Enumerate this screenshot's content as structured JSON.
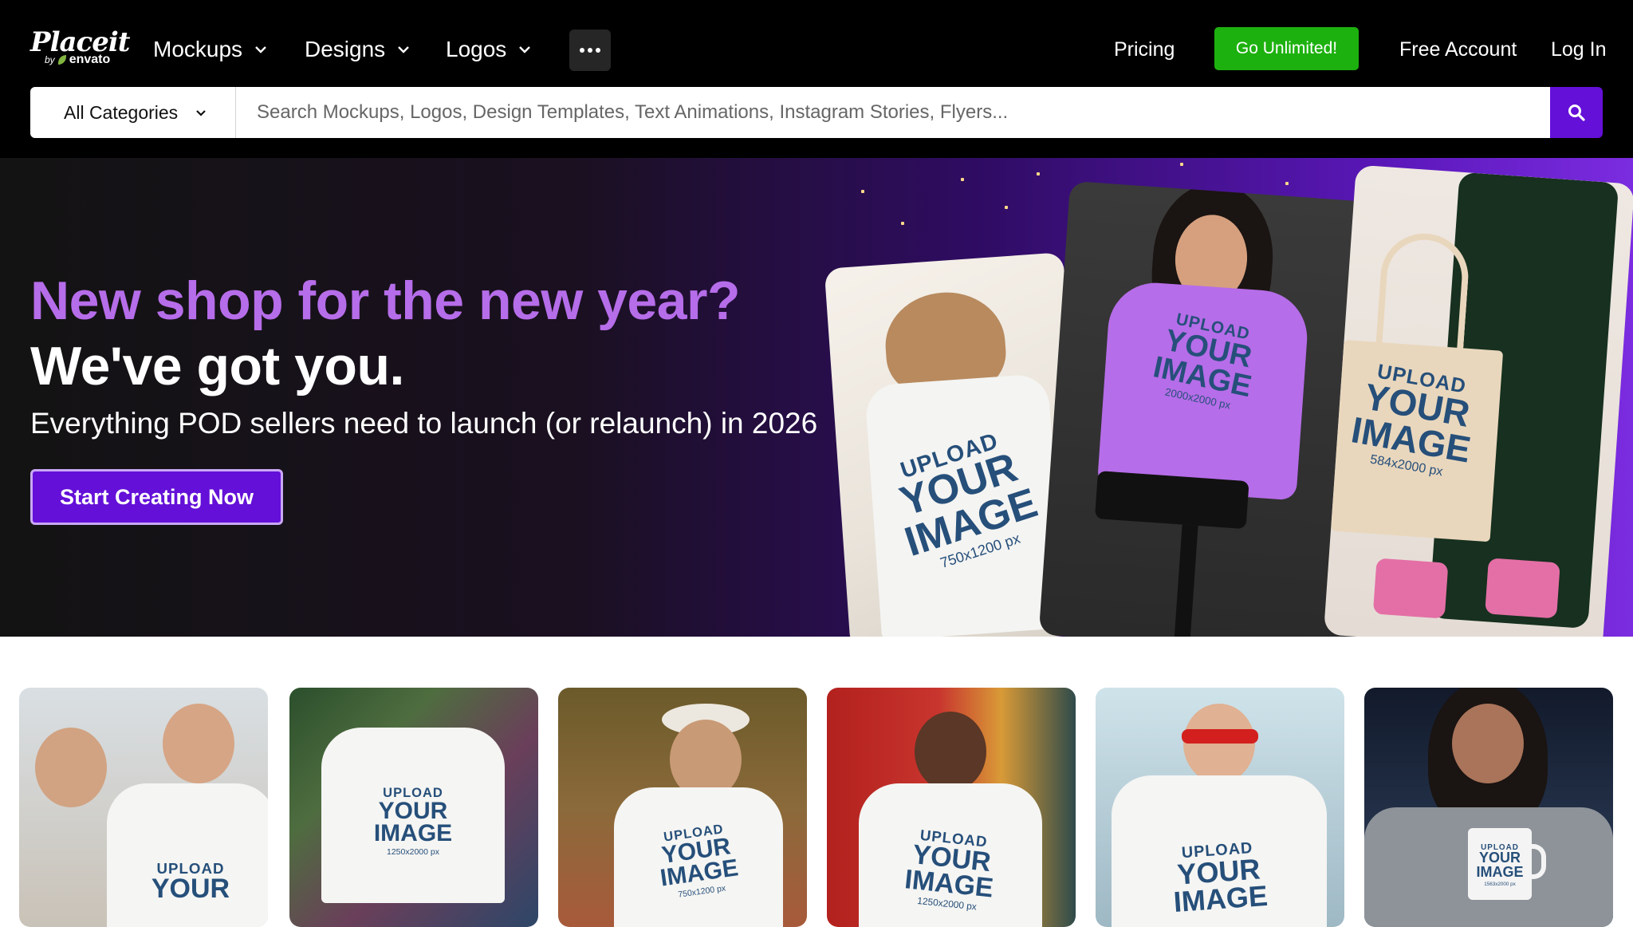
{
  "brand": {
    "name": "Placeit",
    "by": "by",
    "partner": "envato"
  },
  "nav": {
    "items": [
      {
        "label": "Mockups"
      },
      {
        "label": "Designs"
      },
      {
        "label": "Logos"
      }
    ],
    "more_icon": "ellipsis-icon"
  },
  "top_links": {
    "pricing": "Pricing",
    "go_unlimited": "Go Unlimited!",
    "free_account": "Free Account",
    "log_in": "Log In"
  },
  "search": {
    "category": "All Categories",
    "placeholder": "Search Mockups, Logos, Design Templates, Text Animations, Instagram Stories, Flyers...",
    "icon": "search-icon"
  },
  "hero": {
    "title_line_1": "New shop for the new year?",
    "title_line_2": "We've got you.",
    "subtitle": "Everything POD sellers need to launch (or relaunch) in 2026",
    "cta": "Start Creating Now"
  },
  "mockup_text": {
    "upload": "UPLOAD",
    "your": "YOUR",
    "image": "IMAGE",
    "dims_a": "750x1200 px",
    "dims_b": "2000x2000 px",
    "dims_c": "584x2000 px",
    "dims_d": "1250x2000 px",
    "dims_e": "1563x2000 px"
  },
  "colors": {
    "accent_purple": "#6410d8",
    "hero_title_purple": "#b66de9",
    "go_unlimited_green": "#1db10f",
    "header_bg": "#000000",
    "print_text_blue": "#264f7a"
  }
}
